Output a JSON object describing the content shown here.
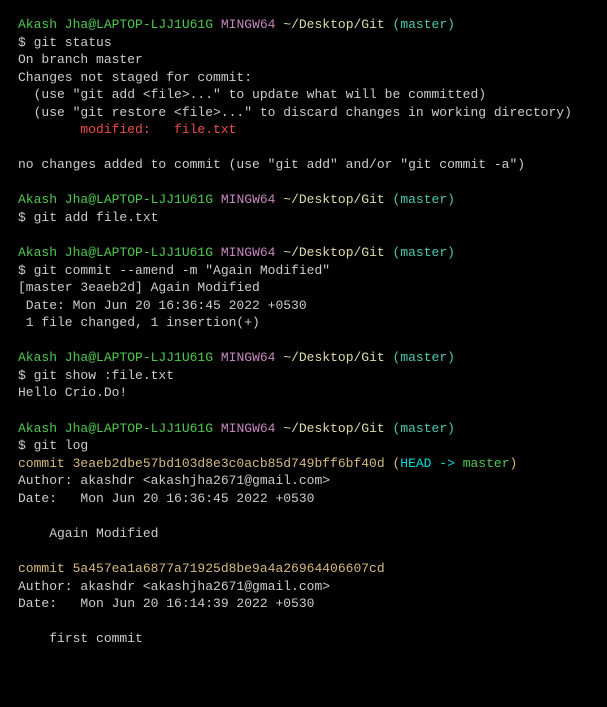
{
  "prompt": {
    "user": "Akash Jha@LAPTOP-LJJ1U61G",
    "shell": "MINGW64",
    "cwd": "~/Desktop/Git",
    "branch": "(master)"
  },
  "blocks": [
    {
      "cmd": "$ git status",
      "out": [
        "On branch master",
        "Changes not staged for commit:",
        "  (use \"git add <file>...\" to update what will be committed)",
        "  (use \"git restore <file>...\" to discard changes in working directory)"
      ],
      "mod_line": "        modified:   file.txt",
      "out2": [
        "no changes added to commit (use \"git add\" and/or \"git commit -a\")"
      ]
    },
    {
      "cmd": "$ git add file.txt",
      "out": []
    },
    {
      "cmd": "$ git commit --amend -m \"Again Modified\"",
      "out": [
        "[master 3eaeb2d] Again Modified",
        " Date: Mon Jun 20 16:36:45 2022 +0530",
        " 1 file changed, 1 insertion(+)"
      ]
    },
    {
      "cmd": "$ git show :file.txt",
      "out": [
        "Hello Crio.Do!"
      ]
    }
  ],
  "log": {
    "cmd": "$ git log",
    "commits": [
      {
        "hash": "commit 3eaeb2dbe57bd103d8e3c0acb85d749bff6bf40d",
        "head": " (",
        "ref1": "HEAD ->",
        "ref2": " master",
        "tail": ")",
        "author": "Author: akashdr <akashjha2671@gmail.com>",
        "date": "Date:   Mon Jun 20 16:36:45 2022 +0530",
        "msg": "    Again Modified"
      },
      {
        "hash": "commit 5a457ea1a6877a71925d8be9a4a26964406607cd",
        "author": "Author: akashdr <akashjha2671@gmail.com>",
        "date": "Date:   Mon Jun 20 16:14:39 2022 +0530",
        "msg": "    first commit"
      }
    ]
  }
}
